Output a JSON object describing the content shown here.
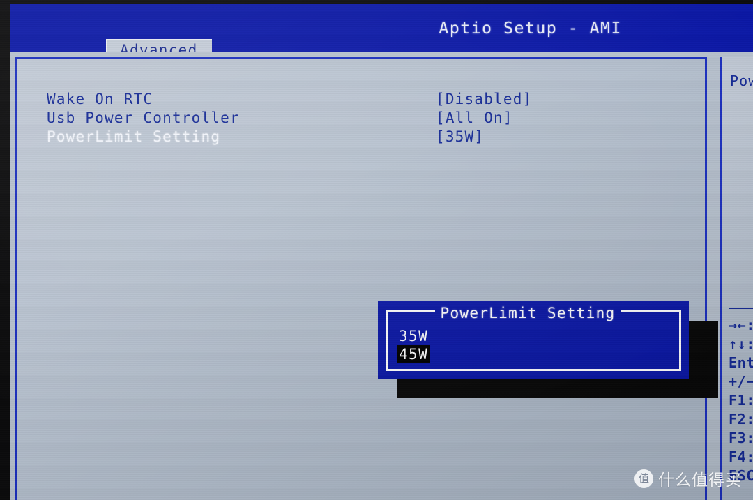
{
  "app": {
    "title": "Aptio Setup - AMI"
  },
  "tabs": [
    {
      "label": "Advanced",
      "active": true
    }
  ],
  "settings": {
    "rows": [
      {
        "label": "Wake On RTC",
        "value": "[Disabled]",
        "selected": false
      },
      {
        "label": "Usb Power Controller",
        "value": "[All On]",
        "selected": false
      },
      {
        "label": "PowerLimit Setting",
        "value": "[35W]",
        "selected": true
      }
    ]
  },
  "popup": {
    "title": "PowerLimit Setting",
    "options": [
      {
        "label": "35W",
        "highlighted": false
      },
      {
        "label": "45W",
        "highlighted": true
      }
    ]
  },
  "side_panel": {
    "help_text": "Pow",
    "keys": [
      {
        "label": "→←:"
      },
      {
        "label": "↑↓:"
      },
      {
        "label": "Ent"
      },
      {
        "label": "+/−"
      },
      {
        "label": "F1:"
      },
      {
        "label": "F2:"
      },
      {
        "label": "F3:"
      },
      {
        "label": "F4:"
      },
      {
        "label": "ESC"
      }
    ]
  },
  "watermark": {
    "badge": "值",
    "text": "什么值得买"
  },
  "colors": {
    "header_blue": "#0b18a6",
    "panel_gray": "#b6c0cd",
    "border_blue": "#1b2fbf",
    "text_navy": "#152a96",
    "text_white": "#f2f5fb",
    "highlight_black": "#000000"
  }
}
